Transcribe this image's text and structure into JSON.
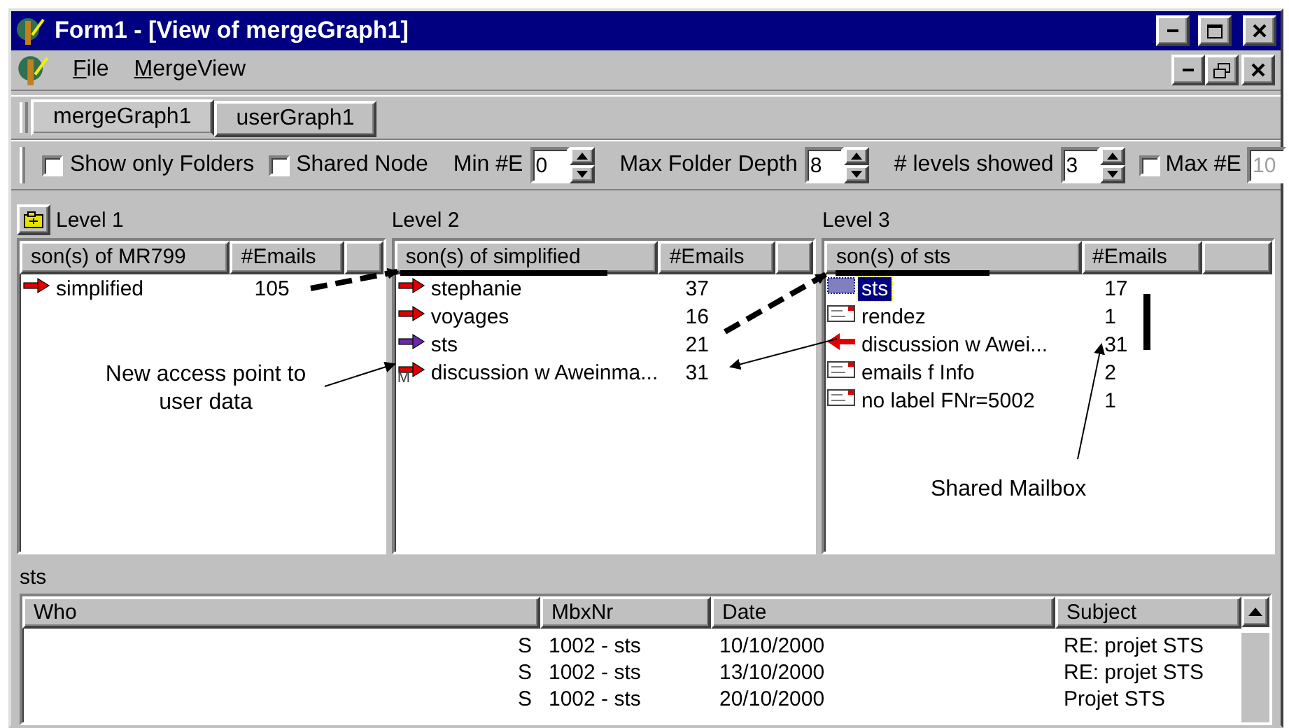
{
  "window": {
    "title": "Form1 - [View of mergeGraph1]"
  },
  "menu": [
    {
      "label": "File"
    },
    {
      "label": "MergeView"
    }
  ],
  "tabs": [
    {
      "label": "mergeGraph1",
      "selected": true
    },
    {
      "label": "userGraph1",
      "selected": false
    }
  ],
  "options": [
    {
      "kind": "checkbox",
      "label": "Show only Folders",
      "checked": false
    },
    {
      "kind": "checkbox",
      "label": "Shared Node",
      "checked": false
    },
    {
      "kind": "spinner",
      "label": "Min #E",
      "value": "0"
    },
    {
      "kind": "spinner",
      "label": "Max Folder Depth",
      "value": "8"
    },
    {
      "kind": "spinner",
      "label": "# levels showed",
      "value": "3"
    },
    {
      "kind": "checkfield",
      "label": "Max #E",
      "checked": false,
      "value": "10",
      "disabled": true
    }
  ],
  "levels": [
    {
      "title": "Level 1",
      "folder_button": true,
      "columns": [
        "son(s) of MR799",
        "#Emails"
      ],
      "rows": [
        {
          "kind": "folder",
          "name": "simplified",
          "count": "105",
          "selected": false
        }
      ]
    },
    {
      "title": "Level 2",
      "folder_button": false,
      "columns": [
        "son(s) of simplified",
        "#Emails"
      ],
      "rows": [
        {
          "kind": "folder",
          "name": "stephanie",
          "count": "37",
          "selected": false
        },
        {
          "kind": "folder",
          "name": "voyages",
          "count": "16",
          "selected": false
        },
        {
          "kind": "shared-folder",
          "name": "sts",
          "count": "21",
          "selected": false
        },
        {
          "kind": "folder",
          "badge": "M",
          "name": "discussion w Aweinma...",
          "count": "31",
          "selected": false
        }
      ]
    },
    {
      "title": "Level 3",
      "folder_button": false,
      "columns": [
        "son(s) of sts",
        "#Emails"
      ],
      "rows": [
        {
          "kind": "mailbox",
          "name": "sts",
          "count": "17",
          "selected": true
        },
        {
          "kind": "message",
          "name": "rendez",
          "count": "1",
          "selected": false
        },
        {
          "kind": "link",
          "name": "discussion w Awei...",
          "count": "31",
          "selected": false
        },
        {
          "kind": "message",
          "name": "emails f Info",
          "count": "2",
          "selected": false
        },
        {
          "kind": "message",
          "name": "no label FNr=5002",
          "count": "1",
          "selected": false
        }
      ]
    }
  ],
  "annotations": [
    {
      "text": "New access point to user data"
    },
    {
      "text": "Shared Mailbox"
    }
  ],
  "detail": {
    "title": "sts",
    "columns": [
      "Who",
      "MbxNr",
      "Date",
      "Subject"
    ],
    "rows": [
      {
        "who": "S",
        "mbx": "1002 - sts",
        "date": "10/10/2000",
        "subject": "RE: projet STS"
      },
      {
        "who": "S",
        "mbx": "1002 - sts",
        "date": "13/10/2000",
        "subject": "RE: projet STS"
      },
      {
        "who": "S",
        "mbx": "1002 - sts",
        "date": "20/10/2000",
        "subject": "Projet STS"
      }
    ]
  }
}
